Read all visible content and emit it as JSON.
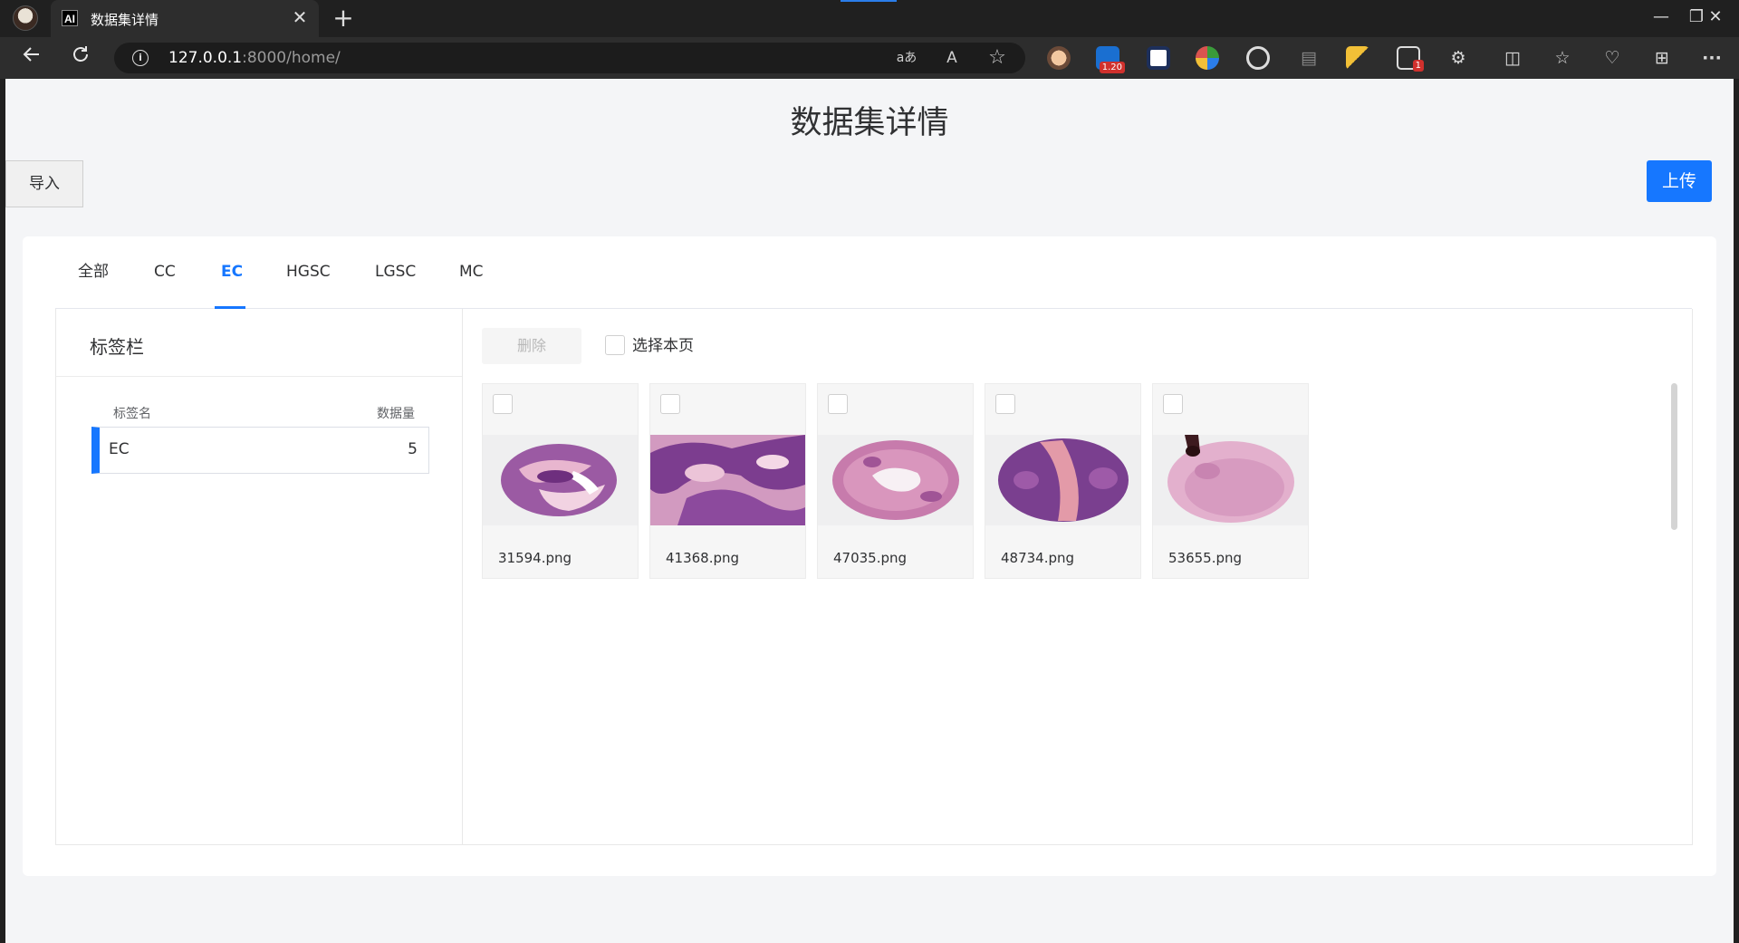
{
  "browser": {
    "tab_title": "数据集详情",
    "tab_favicon": "AI",
    "tab_close_icon": "✕",
    "new_tab_icon": "+",
    "url_host": "127.0.0.1",
    "url_path": ":8000/home/",
    "read_aloud_icon": "aあ",
    "text_size_icon": "A",
    "favorite_icon": "☆",
    "extension_badge_count": "1.20",
    "extension_badge_alert": "1",
    "window_controls": {
      "minimize": "—",
      "restore": "❐",
      "close": "✕"
    },
    "toolbar_menu_icon": "···"
  },
  "page": {
    "title": "数据集详情",
    "import_label": "导入",
    "upload_label": "上传"
  },
  "tabs": [
    {
      "label": "全部",
      "active": false
    },
    {
      "label": "CC",
      "active": false
    },
    {
      "label": "EC",
      "active": true
    },
    {
      "label": "HGSC",
      "active": false
    },
    {
      "label": "LGSC",
      "active": false
    },
    {
      "label": "MC",
      "active": false
    }
  ],
  "sidebar": {
    "title": "标签栏",
    "col_name": "标签名",
    "col_count": "数据量",
    "labels": [
      {
        "name": "EC",
        "count": "5"
      }
    ]
  },
  "content": {
    "delete_label": "删除",
    "select_page_label": "选择本页",
    "images": [
      {
        "filename": "31594.png"
      },
      {
        "filename": "41368.png"
      },
      {
        "filename": "47035.png"
      },
      {
        "filename": "48734.png"
      },
      {
        "filename": "53655.png"
      }
    ]
  },
  "colors": {
    "accent": "#1677ff",
    "tissue_dark": "#7a3f8f",
    "tissue_pink": "#e0a3c2"
  }
}
